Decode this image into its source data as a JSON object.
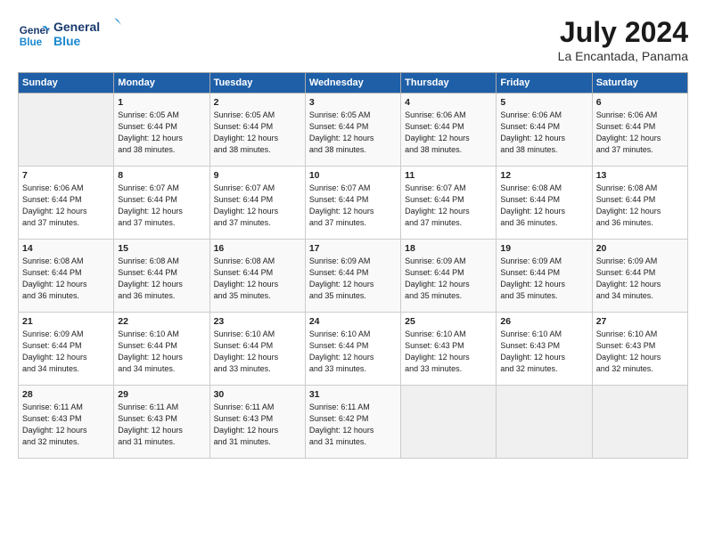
{
  "logo": {
    "line1": "General",
    "line2": "Blue"
  },
  "title": "July 2024",
  "subtitle": "La Encantada, Panama",
  "days_header": [
    "Sunday",
    "Monday",
    "Tuesday",
    "Wednesday",
    "Thursday",
    "Friday",
    "Saturday"
  ],
  "weeks": [
    [
      {
        "day": "",
        "info": ""
      },
      {
        "day": "1",
        "info": "Sunrise: 6:05 AM\nSunset: 6:44 PM\nDaylight: 12 hours\nand 38 minutes."
      },
      {
        "day": "2",
        "info": "Sunrise: 6:05 AM\nSunset: 6:44 PM\nDaylight: 12 hours\nand 38 minutes."
      },
      {
        "day": "3",
        "info": "Sunrise: 6:05 AM\nSunset: 6:44 PM\nDaylight: 12 hours\nand 38 minutes."
      },
      {
        "day": "4",
        "info": "Sunrise: 6:06 AM\nSunset: 6:44 PM\nDaylight: 12 hours\nand 38 minutes."
      },
      {
        "day": "5",
        "info": "Sunrise: 6:06 AM\nSunset: 6:44 PM\nDaylight: 12 hours\nand 38 minutes."
      },
      {
        "day": "6",
        "info": "Sunrise: 6:06 AM\nSunset: 6:44 PM\nDaylight: 12 hours\nand 37 minutes."
      }
    ],
    [
      {
        "day": "7",
        "info": "Sunrise: 6:06 AM\nSunset: 6:44 PM\nDaylight: 12 hours\nand 37 minutes."
      },
      {
        "day": "8",
        "info": "Sunrise: 6:07 AM\nSunset: 6:44 PM\nDaylight: 12 hours\nand 37 minutes."
      },
      {
        "day": "9",
        "info": "Sunrise: 6:07 AM\nSunset: 6:44 PM\nDaylight: 12 hours\nand 37 minutes."
      },
      {
        "day": "10",
        "info": "Sunrise: 6:07 AM\nSunset: 6:44 PM\nDaylight: 12 hours\nand 37 minutes."
      },
      {
        "day": "11",
        "info": "Sunrise: 6:07 AM\nSunset: 6:44 PM\nDaylight: 12 hours\nand 37 minutes."
      },
      {
        "day": "12",
        "info": "Sunrise: 6:08 AM\nSunset: 6:44 PM\nDaylight: 12 hours\nand 36 minutes."
      },
      {
        "day": "13",
        "info": "Sunrise: 6:08 AM\nSunset: 6:44 PM\nDaylight: 12 hours\nand 36 minutes."
      }
    ],
    [
      {
        "day": "14",
        "info": "Sunrise: 6:08 AM\nSunset: 6:44 PM\nDaylight: 12 hours\nand 36 minutes."
      },
      {
        "day": "15",
        "info": "Sunrise: 6:08 AM\nSunset: 6:44 PM\nDaylight: 12 hours\nand 36 minutes."
      },
      {
        "day": "16",
        "info": "Sunrise: 6:08 AM\nSunset: 6:44 PM\nDaylight: 12 hours\nand 35 minutes."
      },
      {
        "day": "17",
        "info": "Sunrise: 6:09 AM\nSunset: 6:44 PM\nDaylight: 12 hours\nand 35 minutes."
      },
      {
        "day": "18",
        "info": "Sunrise: 6:09 AM\nSunset: 6:44 PM\nDaylight: 12 hours\nand 35 minutes."
      },
      {
        "day": "19",
        "info": "Sunrise: 6:09 AM\nSunset: 6:44 PM\nDaylight: 12 hours\nand 35 minutes."
      },
      {
        "day": "20",
        "info": "Sunrise: 6:09 AM\nSunset: 6:44 PM\nDaylight: 12 hours\nand 34 minutes."
      }
    ],
    [
      {
        "day": "21",
        "info": "Sunrise: 6:09 AM\nSunset: 6:44 PM\nDaylight: 12 hours\nand 34 minutes."
      },
      {
        "day": "22",
        "info": "Sunrise: 6:10 AM\nSunset: 6:44 PM\nDaylight: 12 hours\nand 34 minutes."
      },
      {
        "day": "23",
        "info": "Sunrise: 6:10 AM\nSunset: 6:44 PM\nDaylight: 12 hours\nand 33 minutes."
      },
      {
        "day": "24",
        "info": "Sunrise: 6:10 AM\nSunset: 6:44 PM\nDaylight: 12 hours\nand 33 minutes."
      },
      {
        "day": "25",
        "info": "Sunrise: 6:10 AM\nSunset: 6:43 PM\nDaylight: 12 hours\nand 33 minutes."
      },
      {
        "day": "26",
        "info": "Sunrise: 6:10 AM\nSunset: 6:43 PM\nDaylight: 12 hours\nand 32 minutes."
      },
      {
        "day": "27",
        "info": "Sunrise: 6:10 AM\nSunset: 6:43 PM\nDaylight: 12 hours\nand 32 minutes."
      }
    ],
    [
      {
        "day": "28",
        "info": "Sunrise: 6:11 AM\nSunset: 6:43 PM\nDaylight: 12 hours\nand 32 minutes."
      },
      {
        "day": "29",
        "info": "Sunrise: 6:11 AM\nSunset: 6:43 PM\nDaylight: 12 hours\nand 31 minutes."
      },
      {
        "day": "30",
        "info": "Sunrise: 6:11 AM\nSunset: 6:43 PM\nDaylight: 12 hours\nand 31 minutes."
      },
      {
        "day": "31",
        "info": "Sunrise: 6:11 AM\nSunset: 6:42 PM\nDaylight: 12 hours\nand 31 minutes."
      },
      {
        "day": "",
        "info": ""
      },
      {
        "day": "",
        "info": ""
      },
      {
        "day": "",
        "info": ""
      }
    ]
  ]
}
